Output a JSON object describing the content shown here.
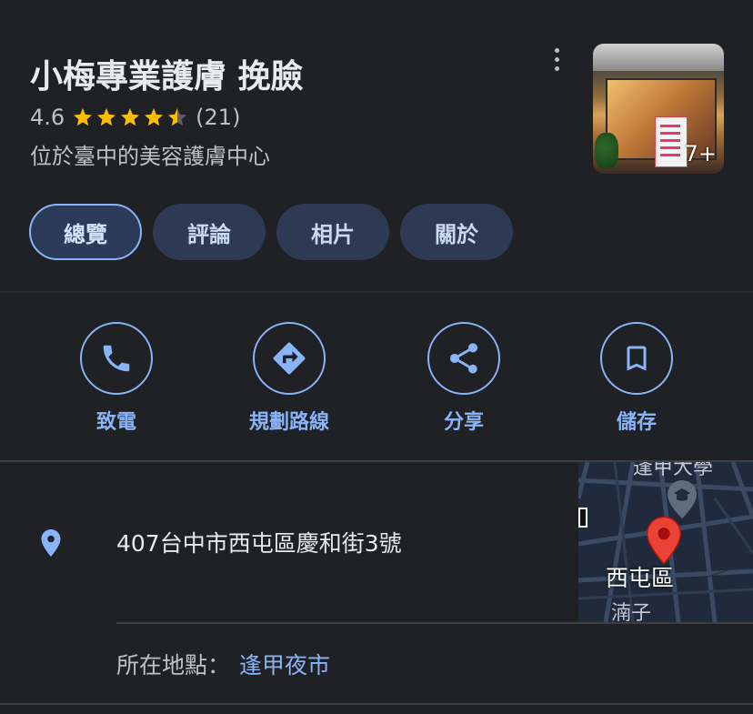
{
  "place": {
    "name": "小梅專業護膚 挽臉",
    "rating": "4.6",
    "review_count": "(21)",
    "stars_filled": 4.5,
    "category": "位於臺中的美容護膚中心",
    "photo_count": "7+"
  },
  "tabs": [
    {
      "label": "總覽",
      "active": true
    },
    {
      "label": "評論",
      "active": false
    },
    {
      "label": "相片",
      "active": false
    },
    {
      "label": "關於",
      "active": false
    }
  ],
  "actions": [
    {
      "label": "致電",
      "icon": "phone-icon"
    },
    {
      "label": "規劃路線",
      "icon": "directions-icon"
    },
    {
      "label": "分享",
      "icon": "share-icon"
    },
    {
      "label": "儲存",
      "icon": "bookmark-icon"
    }
  ],
  "address": {
    "text": "407台中市西屯區慶和街3號",
    "icon": "location-pin-icon"
  },
  "map": {
    "district_label": "西屯區",
    "area_label": "湳子",
    "top_label": "逢甲大學"
  },
  "located_in": {
    "label": "所在地點：",
    "value": "逢甲夜市"
  },
  "colors": {
    "background": "#202124",
    "accent": "#8ab4f8",
    "star": "#fbbc04",
    "tab_bg": "#2e3a54",
    "pin_red": "#ea4335"
  }
}
